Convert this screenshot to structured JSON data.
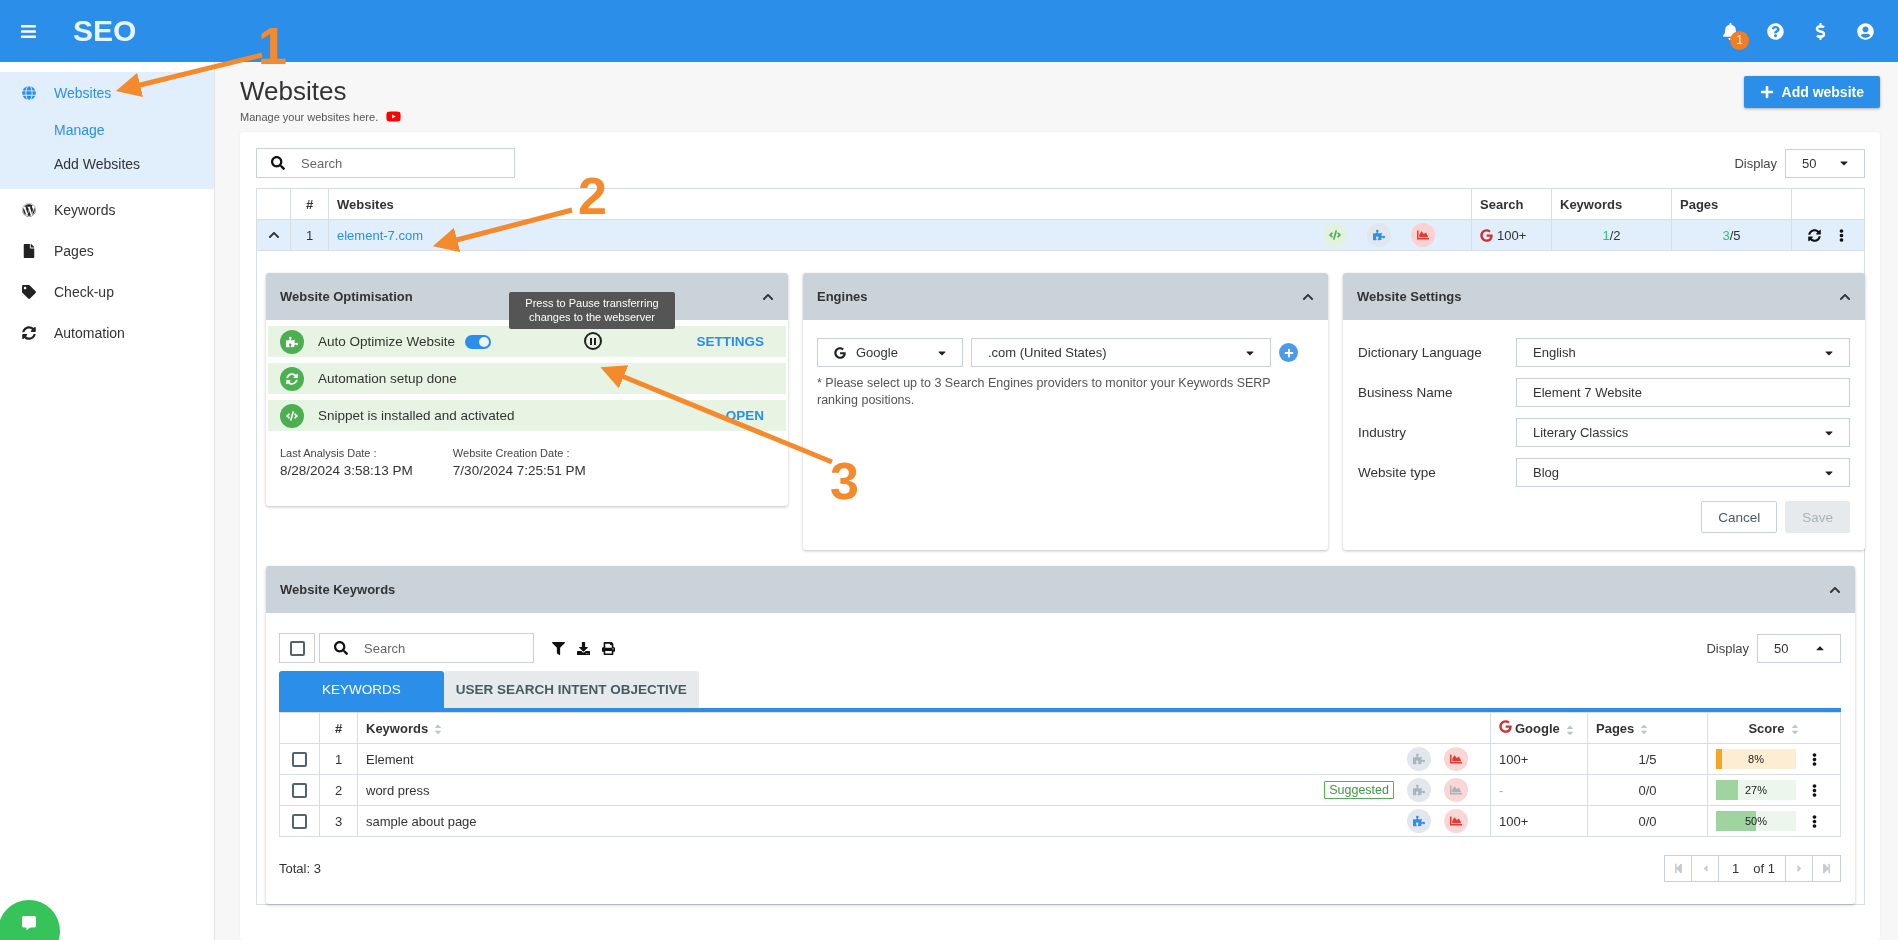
{
  "header": {
    "title": "SEO",
    "notification_count": "1"
  },
  "sidebar": {
    "items": [
      {
        "label": "Websites",
        "kind": "globe",
        "selected": true,
        "expanded": true,
        "children": [
          {
            "label": "Manage",
            "selected": true
          },
          {
            "label": "Add Websites",
            "selected": false
          }
        ]
      },
      {
        "label": "Keywords",
        "kind": "wordpress",
        "selected": false
      },
      {
        "label": "Pages",
        "kind": "file",
        "selected": false
      },
      {
        "label": "Check-up",
        "kind": "tag",
        "selected": false
      },
      {
        "label": "Automation",
        "kind": "sync",
        "selected": false
      }
    ]
  },
  "page": {
    "title": "Websites",
    "subtitle": "Manage your websites here.",
    "add_button": "Add website"
  },
  "websites_table": {
    "search_placeholder": "Search",
    "display_label": "Display",
    "display_value": "50",
    "columns": [
      "#",
      "Websites",
      "Search",
      "Keywords",
      "Pages"
    ],
    "rows": [
      {
        "expanded": true,
        "index": "1",
        "website": "element-7.com",
        "search": "100+",
        "keywords_done": "1",
        "keywords_rest": "/2",
        "pages_done": "3",
        "pages_rest": "/5"
      }
    ]
  },
  "optimisation": {
    "title": "Website Optimisation",
    "tooltip": "Press to Pause transferring changes to the webserver",
    "items": [
      {
        "kind": "toggle",
        "label": "Auto Optimize Website",
        "on": true,
        "action": "SETTINGS"
      },
      {
        "kind": "automation",
        "label": "Automation setup done"
      },
      {
        "kind": "snippet",
        "label": "Snippet is installed and activated",
        "action": "OPEN"
      }
    ],
    "dates": [
      {
        "label": "Last Analysis Date :",
        "value": "8/28/2024 3:58:13 PM"
      },
      {
        "label": "Website Creation Date :",
        "value": "7/30/2024 7:25:51 PM"
      }
    ]
  },
  "engines": {
    "title": "Engines",
    "engine": "Google",
    "domain": ".com (United States)",
    "note": "* Please select up to 3 Search Engines providers to monitor your Keywords SERP ranking positions."
  },
  "settings": {
    "title": "Website Settings",
    "fields": [
      {
        "kind": "select",
        "label": "Dictionary Language",
        "value": "English"
      },
      {
        "kind": "text",
        "label": "Business Name",
        "value": "Element 7 Website"
      },
      {
        "kind": "select",
        "label": "Industry",
        "value": "Literary Classics"
      },
      {
        "kind": "select",
        "label": "Website type",
        "value": "Blog"
      }
    ],
    "cancel": "Cancel",
    "save": "Save",
    "save_disabled": true
  },
  "keywords": {
    "title": "Website Keywords",
    "select_all_checked": false,
    "search_placeholder": "Search",
    "display_label": "Display",
    "display_value": "50",
    "tabs": [
      {
        "label": "KEYWORDS",
        "selected": true
      },
      {
        "label": "USER SEARCH INTENT OBJECTIVE",
        "selected": false
      }
    ],
    "columns": [
      "#",
      "Keywords",
      "Google",
      "Pages",
      "Score"
    ],
    "rows": [
      {
        "checked": false,
        "index": "1",
        "keyword": "Element",
        "suggested": false,
        "optimize_active": false,
        "report_active": true,
        "google": "100+",
        "pages": "1/5",
        "score": "8%",
        "level": 0.08,
        "color": "#f5a623"
      },
      {
        "checked": false,
        "index": "2",
        "keyword": "word press",
        "suggested": true,
        "badge": "Suggested",
        "optimize_active": false,
        "report_active": false,
        "google": "-",
        "pages": "0/0",
        "score": "27%",
        "level": 0.27,
        "color": "#9fd3a0"
      },
      {
        "checked": false,
        "index": "3",
        "keyword": "sample about page",
        "suggested": false,
        "optimize_active": true,
        "report_active": true,
        "google": "100+",
        "pages": "0/0",
        "score": "50%",
        "level": 0.5,
        "color": "#9fd3a0"
      }
    ],
    "total": "Total: 3",
    "page": "1",
    "page_of": "of 1"
  },
  "annotations": [
    {
      "label": "1"
    },
    {
      "label": "2"
    },
    {
      "label": "3"
    }
  ]
}
